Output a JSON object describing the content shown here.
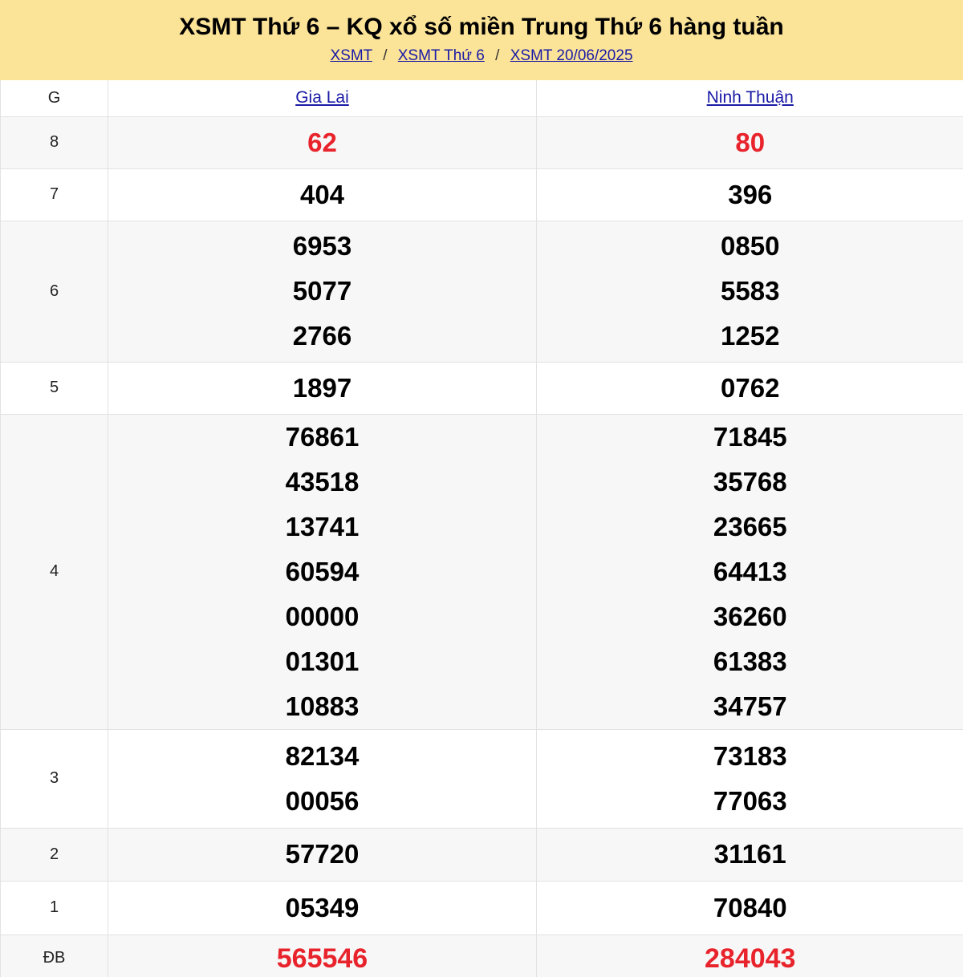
{
  "header": {
    "title": "XSMT Thứ 6 – KQ xổ số miền Trung Thứ 6 hàng tuần",
    "breadcrumb": [
      "XSMT",
      "XSMT Thứ 6",
      "XSMT 20/06/2025"
    ],
    "separator": "/"
  },
  "table": {
    "col_header": "G",
    "provinces": [
      "Gia Lai",
      "Ninh Thuận"
    ],
    "prizes": [
      {
        "label": "8",
        "gia_lai": [
          "62"
        ],
        "ninh_thuan": [
          "80"
        ],
        "highlight": true
      },
      {
        "label": "7",
        "gia_lai": [
          "404"
        ],
        "ninh_thuan": [
          "396"
        ]
      },
      {
        "label": "6",
        "gia_lai": [
          "6953",
          "5077",
          "2766"
        ],
        "ninh_thuan": [
          "0850",
          "5583",
          "1252"
        ]
      },
      {
        "label": "5",
        "gia_lai": [
          "1897"
        ],
        "ninh_thuan": [
          "0762"
        ]
      },
      {
        "label": "4",
        "gia_lai": [
          "76861",
          "43518",
          "13741",
          "60594",
          "00000",
          "01301",
          "10883"
        ],
        "ninh_thuan": [
          "71845",
          "35768",
          "23665",
          "64413",
          "36260",
          "61383",
          "34757"
        ]
      },
      {
        "label": "3",
        "gia_lai": [
          "82134",
          "00056"
        ],
        "ninh_thuan": [
          "73183",
          "77063"
        ]
      },
      {
        "label": "2",
        "gia_lai": [
          "57720"
        ],
        "ninh_thuan": [
          "31161"
        ]
      },
      {
        "label": "1",
        "gia_lai": [
          "05349"
        ],
        "ninh_thuan": [
          "70840"
        ]
      },
      {
        "label": "ĐB",
        "gia_lai": [
          "565546"
        ],
        "ninh_thuan": [
          "284043"
        ],
        "highlight": true
      }
    ]
  },
  "colors": {
    "header_bg": "#fbe398",
    "link": "#1a1aa6",
    "highlight": "#e8232b",
    "alt_row": "#f7f7f7"
  }
}
